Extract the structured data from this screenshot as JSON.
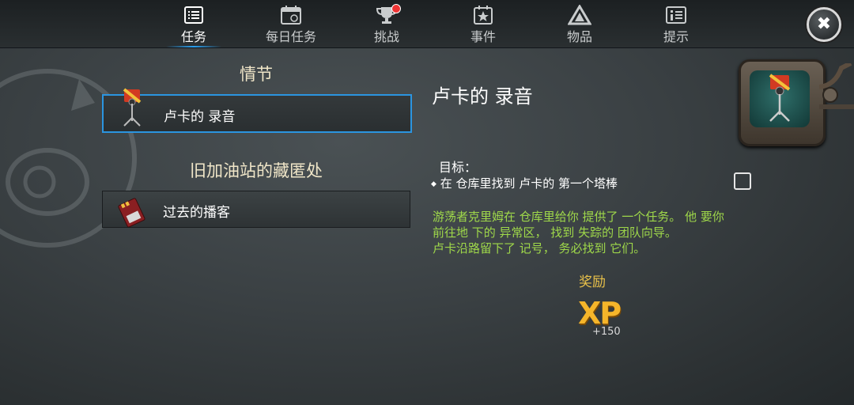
{
  "nav": {
    "tabs": [
      {
        "label": "任务",
        "icon": "list-icon",
        "active": true
      },
      {
        "label": "每日任务",
        "icon": "calendar-icon",
        "active": false
      },
      {
        "label": "挑战",
        "icon": "trophy-icon",
        "active": false,
        "badge": true
      },
      {
        "label": "事件",
        "icon": "star-calendar-icon",
        "active": false
      },
      {
        "label": "物品",
        "icon": "triangle-icon",
        "active": false
      },
      {
        "label": "提示",
        "icon": "info-icon",
        "active": false
      }
    ],
    "close_icon": "✖"
  },
  "left": {
    "section1_title": "情节",
    "section1_item": "卢卡的 录音",
    "section2_title": "旧加油站的藏匿处",
    "section2_item": "过去的播客"
  },
  "detail": {
    "title": "卢卡的 录音",
    "objective_label": "目标：",
    "objective": "在 仓库里找到 卢卡的 第一个塔棒",
    "objective_done": false,
    "description_lines": [
      "游荡者克里姆在 仓库里给你 提供了 一个任务。 他 要你",
      "前往地 下的 异常区， 找到 失踪的 团队向导。",
      "卢卡沿路留下了 记号， 务必找到 它们。"
    ],
    "reward_label": "奖励",
    "reward_xp_text": "XP",
    "reward_amount": "+150"
  },
  "colors": {
    "accent_blue": "#2b95e0",
    "description_green": "#9fd84a",
    "reward_gold": "#e9c14a",
    "xp_orange": "#f5b52a"
  }
}
